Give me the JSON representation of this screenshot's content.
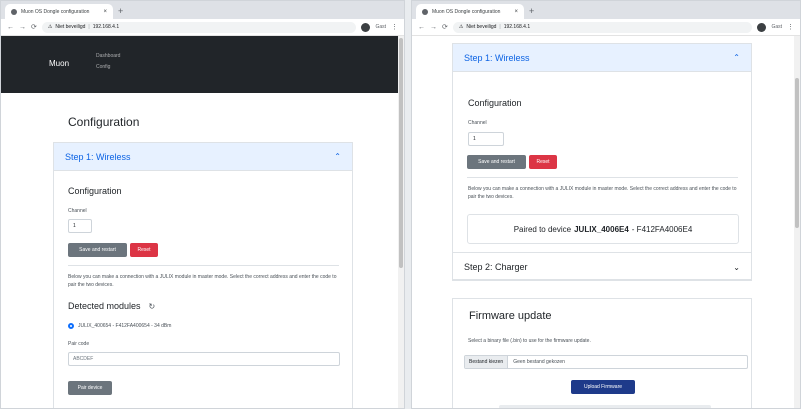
{
  "browser_left": {
    "tab_title": "Muon OS Dongle configuration",
    "address_security": "Niet beveiligd",
    "address_host": "192.168.4.1",
    "profile_label": "Gast"
  },
  "browser_right": {
    "tab_title": "Muon OS Dongle configuration",
    "address_security": "Niet beveiligd",
    "address_host": "192.168.4.1",
    "profile_label": "Gast"
  },
  "navbar": {
    "brand": "Muon",
    "links": [
      "Dashboard",
      "Config"
    ]
  },
  "page": {
    "title": "Configuration"
  },
  "accordion": {
    "step1_label": "Step 1: Wireless",
    "step2_label": "Step 2: Charger"
  },
  "wireless": {
    "section_title": "Configuration",
    "channel_label": "Channel",
    "channel_value": "1",
    "save_label": "Save and restart",
    "reset_label": "Reset",
    "description": "Below you can make a connection with a JULIX module in master mode. Select the correct address and enter the code to pair the two devices.",
    "detected_title": "Detected modules",
    "module_entry": "JULIX_400654 - F412FA400654 - 34 dBm",
    "pair_code_label": "Pair code",
    "pair_code_placeholder": "ABCDEF",
    "pair_button_label": "Pair device",
    "paired_prefix": "Paired to device",
    "paired_device": "JULIX_4006E4",
    "paired_suffix": " - F412FA4006E4"
  },
  "firmware": {
    "title": "Firmware update",
    "description": "Select a binary file (.bin) to use for the firmware update.",
    "file_button": "Bestand kiezen",
    "file_name": "Geen bestand gekozen",
    "upload_label": "Upload Firmware"
  },
  "icons": {
    "favicon": "globe-icon",
    "back": "←",
    "forward": "→",
    "reload": "⟳",
    "lock": "⚠",
    "chevron_up": "⌃",
    "chevron_down": "⌄",
    "refresh": "↻",
    "close": "×",
    "new_tab": "+"
  },
  "colors": {
    "accent": "#0c63e4",
    "danger": "#dc3545",
    "secondary": "#6c757d",
    "primary_dark": "#1e3a8a",
    "navbar": "#212529"
  }
}
